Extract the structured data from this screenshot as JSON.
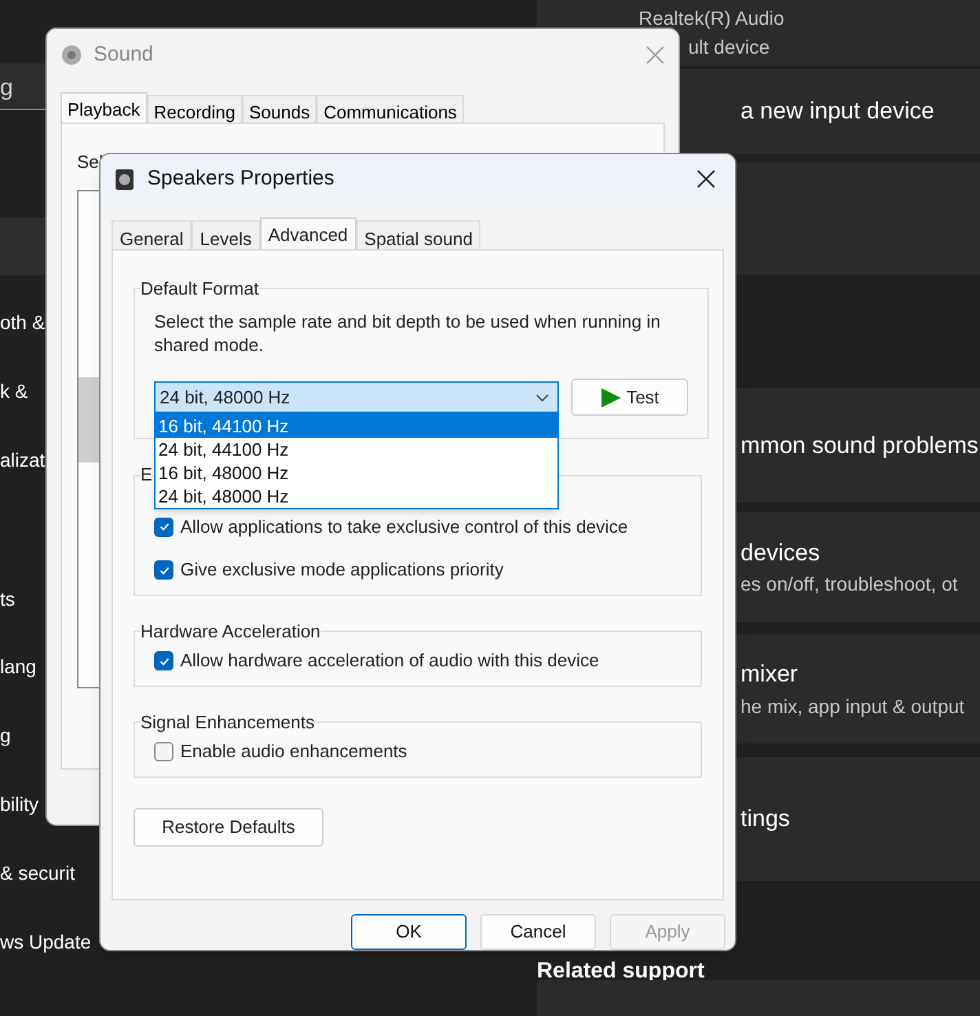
{
  "settings_background": {
    "sidebar": {
      "search_value": "g",
      "items": [
        "oth &",
        "k &",
        "alizat",
        "ts",
        "lang",
        "g",
        "bility",
        "& securit",
        "ws Update"
      ]
    },
    "cards": [
      {
        "title": "Realtek(R) Audio",
        "subtitle": "ult device"
      },
      {
        "title": "a new input device"
      },
      {
        "title": "mmon sound problems"
      },
      {
        "title": "devices",
        "subtitle": "es on/off, troubleshoot, ot"
      },
      {
        "title": "mixer",
        "subtitle": "he mix, app input & output"
      },
      {
        "title": "tings"
      }
    ],
    "related_heading": "Related support"
  },
  "sound_window": {
    "title": "Sound",
    "tabs": [
      {
        "label": "Playback",
        "selected": true
      },
      {
        "label": "Recording",
        "selected": false
      },
      {
        "label": "Sounds",
        "selected": false
      },
      {
        "label": "Communications",
        "selected": false
      }
    ],
    "instruction": "Sel"
  },
  "speakers_properties": {
    "title": "Speakers Properties",
    "tabs": [
      {
        "label": "General",
        "selected": false
      },
      {
        "label": "Levels",
        "selected": false
      },
      {
        "label": "Advanced",
        "selected": true
      },
      {
        "label": "Spatial sound",
        "selected": false
      }
    ],
    "default_format": {
      "heading": "Default Format",
      "description": "Select the sample rate and bit depth to be used when running in shared mode.",
      "value": "24 bit, 48000 Hz",
      "test_button": "Test",
      "options": [
        {
          "label": "16 bit, 44100 Hz",
          "highlighted": true
        },
        {
          "label": "24 bit, 44100 Hz",
          "highlighted": false
        },
        {
          "label": "16 bit, 48000 Hz",
          "highlighted": false
        },
        {
          "label": "24 bit, 48000 Hz",
          "highlighted": false
        }
      ]
    },
    "groups": [
      {
        "heading": "E",
        "options": [
          {
            "label": "Allow applications to take exclusive control of this device",
            "checked": true
          },
          {
            "label": "Give exclusive mode applications priority",
            "checked": true
          }
        ]
      },
      {
        "heading": "Hardware Acceleration",
        "options": [
          {
            "label": "Allow hardware acceleration of audio with this device",
            "checked": true
          }
        ]
      },
      {
        "heading": "Signal Enhancements",
        "options": [
          {
            "label": "Enable audio enhancements",
            "checked": false
          }
        ]
      }
    ],
    "restore_button": "Restore Defaults",
    "buttons": [
      {
        "label": "OK",
        "kind": "default",
        "disabled": false
      },
      {
        "label": "Cancel",
        "kind": "normal",
        "disabled": false
      },
      {
        "label": "Apply",
        "kind": "normal",
        "disabled": true
      }
    ]
  }
}
